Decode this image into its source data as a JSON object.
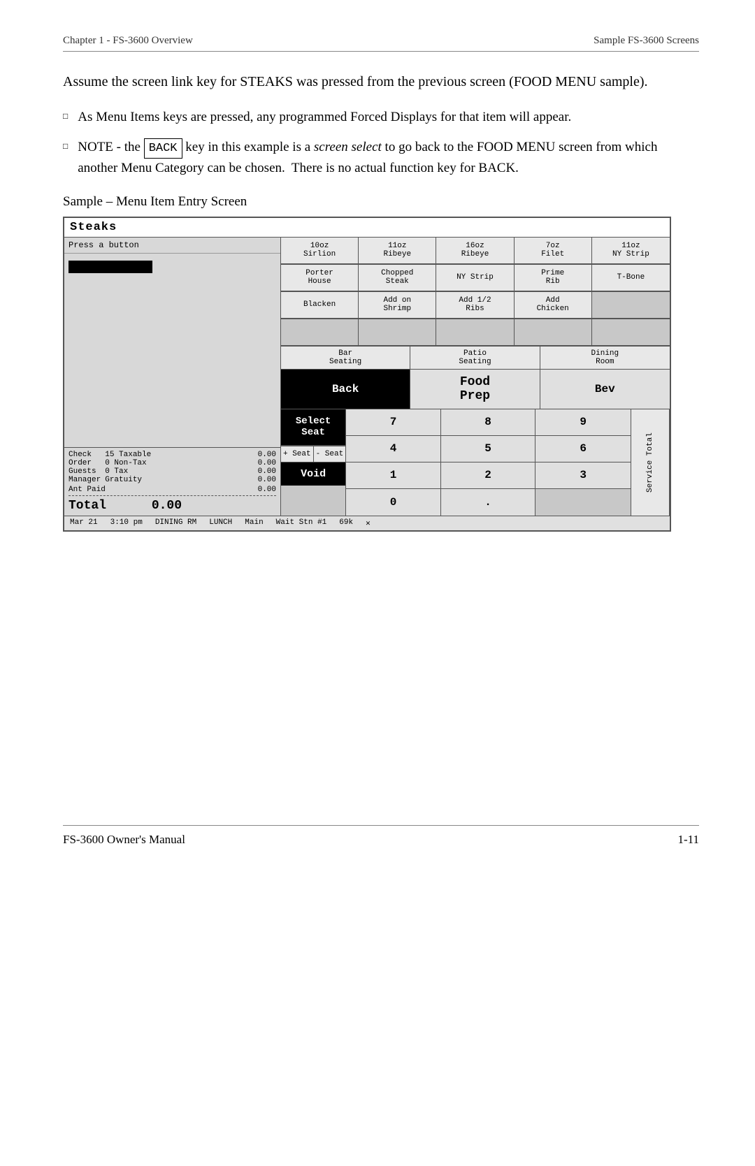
{
  "header": {
    "left": "Chapter 1 - FS-3600 Overview",
    "right": "Sample FS-3600 Screens"
  },
  "intro": {
    "p1": "Assume the screen link key for STEAKS was pressed from the previous screen (FOOD MENU sample).",
    "bullet1": "As Menu Items keys are pressed, any programmed Forced Displays for that item will appear.",
    "bullet2_pre": "NOTE - the ",
    "bullet2_key": "BACK",
    "bullet2_post": " key in this example is a screen select to go back to the FOOD MENU screen from which another Menu Category can be chosen.  There is no actual function key for BACK."
  },
  "sample_label": "Sample – Menu Item Entry Screen",
  "pos": {
    "title": "Steaks",
    "press_btn": "Press a button",
    "menu_row1": [
      "10oz\nSirlion",
      "11oz\nRibeye",
      "16oz\nRibeye",
      "7oz\nFilet",
      "11oz\nNY Strip"
    ],
    "menu_row2": [
      "Porter\nHouse",
      "Chopped\nSteak",
      "NY Strip",
      "Prime\nRib",
      "T-Bone"
    ],
    "menu_row3": [
      "Blacken",
      "Add on\nShrimp",
      "Add 1/2\nRibs",
      "Add\nChicken",
      ""
    ],
    "menu_row4_empty": [
      "",
      "",
      "",
      "",
      ""
    ],
    "seating": [
      "Bar\nSeating",
      "Patio\nSeating",
      "Dining\nRoom"
    ],
    "back_btn": "Back",
    "food_prep_btn": "Food\nPrep",
    "bev_btn": "Bev",
    "select_seat_btn": "Select\nSeat",
    "num7": "7",
    "num8": "8",
    "num9": "9",
    "num4": "4",
    "num5": "5",
    "num6": "6",
    "num1": "1",
    "num2": "2",
    "num3": "3",
    "num0": "0",
    "num_dot": ".",
    "plus_seat": "+ Seat",
    "minus_seat": "- Seat",
    "void_btn": "Void",
    "service_total": "Service\nTotal",
    "totals": {
      "check_label": "Check",
      "check_val": "15 Taxable",
      "check_amt": "0.00",
      "order_label": "Order",
      "order_val": "0 Non-Tax",
      "order_amt": "0.00",
      "guests_label": "Guests",
      "guests_val": "0 Tax",
      "guests_amt": "0.00",
      "manager_label": "Manager",
      "gratuity_label": "Gratuity",
      "gratuity_amt": "0.00",
      "ant_paid_label": "Ant Paid",
      "ant_paid_amt": "0.00",
      "total_label": "Total",
      "total_val": "0.00"
    },
    "status_bar": "Mar 21   3:10 pm   DINING RM   LUNCH      Main         Wait Stn #1    69k   ✕"
  },
  "footer": {
    "left": "FS-3600 Owner's Manual",
    "right": "1-11"
  }
}
